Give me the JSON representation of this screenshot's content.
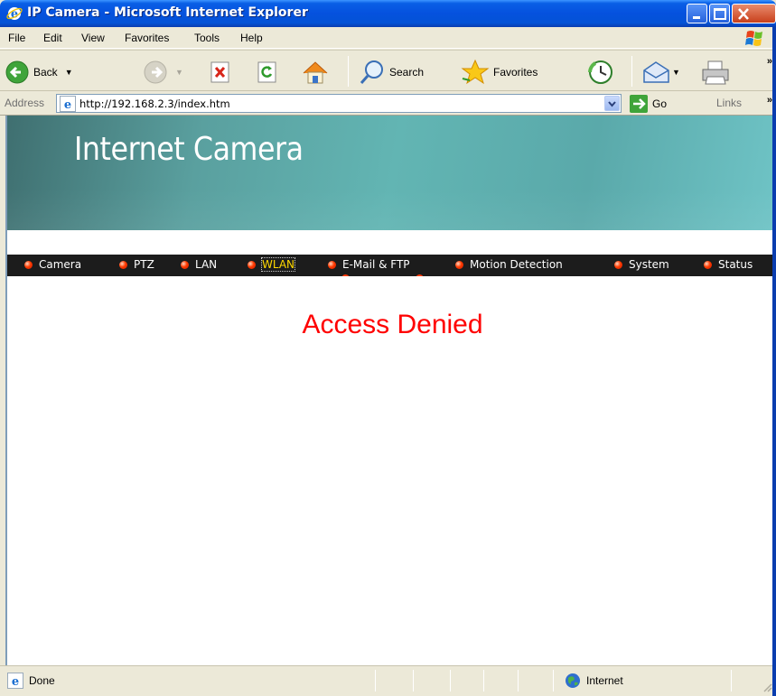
{
  "window": {
    "title": "IP Camera - Microsoft Internet Explorer",
    "titlebar_color": "#0551DE"
  },
  "menu": {
    "items": [
      "File",
      "Edit",
      "View",
      "Favorites",
      "Tools",
      "Help"
    ]
  },
  "toolbar": {
    "back_label": "Back",
    "search_label": "Search",
    "favorites_label": "Favorites"
  },
  "address": {
    "label": "Address",
    "url": "http://192.168.2.3/index.htm",
    "go_label": "Go",
    "links_label": "Links"
  },
  "page": {
    "banner_title": "Internet Camera",
    "nav": [
      {
        "label": "Camera"
      },
      {
        "label": "PTZ"
      },
      {
        "label": "LAN"
      },
      {
        "label": "WLAN"
      },
      {
        "label": "E-Mail & FTP"
      },
      {
        "label": "Motion Detection"
      },
      {
        "label": "System"
      },
      {
        "label": "Status"
      }
    ],
    "active_nav": "WLAN",
    "message": "Access Denied",
    "message_color": "#ff0000"
  },
  "status": {
    "text": "Done",
    "zone": "Internet"
  }
}
